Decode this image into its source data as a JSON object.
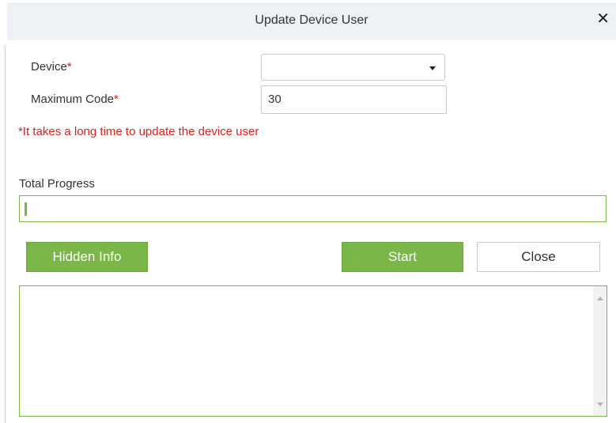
{
  "dialog": {
    "title": "Update Device User",
    "close_icon": "close-icon",
    "close_glyph": "✕"
  },
  "form": {
    "device_label": "Device",
    "device_value": "",
    "maximum_code_label": "Maximum Code",
    "maximum_code_value": "30",
    "required_mark": "*",
    "warning": "*It takes a long time to update the device user"
  },
  "progress": {
    "label": "Total Progress",
    "value_fraction": 0.0
  },
  "buttons": {
    "hidden_info": "Hidden Info",
    "start": "Start",
    "close": "Close"
  },
  "colors": {
    "accent_green": "#7ab648",
    "required_red": "#e02020",
    "titlebar_bg": "#eef1f6"
  }
}
